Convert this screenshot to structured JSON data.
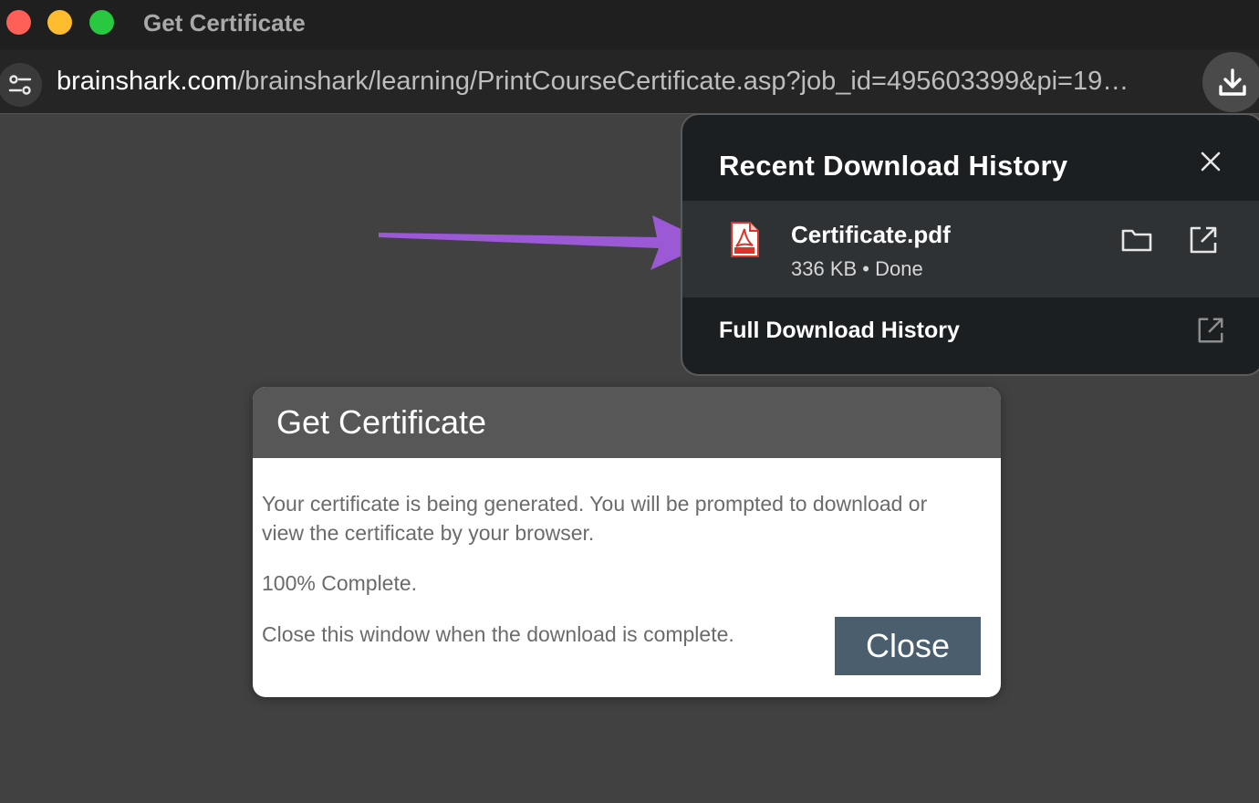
{
  "window": {
    "title": "Get Certificate",
    "traffic_colors": [
      "#fe5f57",
      "#febc2e",
      "#28c840"
    ]
  },
  "address_bar": {
    "host": "brainshark.com",
    "path": "/brainshark/learning/PrintCourseCertificate.asp?job_id=495603399&pi=19…",
    "site_settings_icon": "tune-icon",
    "download_icon": "download-icon"
  },
  "downloads_panel": {
    "title": "Recent Download History",
    "close_icon": "close-icon",
    "items": [
      {
        "filename": "Certificate.pdf",
        "size": "336 KB",
        "separator": "•",
        "status": "Done",
        "file_icon": "pdf-icon",
        "actions": [
          "folder-icon",
          "open-external-icon"
        ]
      }
    ],
    "full_history_label": "Full Download History"
  },
  "annotation": {
    "arrow_color": "#9b59d6"
  },
  "dialog": {
    "title": "Get Certificate",
    "message": "Your certificate is being generated. You will be prompted to download or view the certificate by your browser.",
    "progress": "100% Complete.",
    "progress_fraction": 1.0,
    "instruction": "Close this window when the download is complete.",
    "close_label": "Close",
    "accent": "#4a5e6e"
  }
}
